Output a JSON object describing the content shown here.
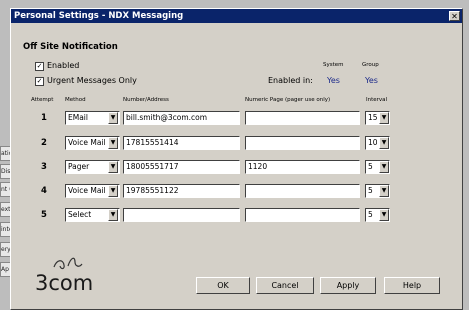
{
  "background": {
    "strips": [
      "ation",
      "Dis",
      "nt (",
      "ext",
      "inte",
      "eryM",
      "Ap"
    ]
  },
  "dialog": {
    "title": "Personal Settings - NDX Messaging",
    "close_glyph": "✕",
    "section_title": "Off Site Notification",
    "enabled_label": "Enabled",
    "enabled_checked": "✓",
    "urgent_label": "Urgent Messages Only",
    "urgent_checked": "✓",
    "enabled_in_label": "Enabled in:",
    "system_header": "System",
    "group_header": "Group",
    "system_value": "Yes",
    "group_value": "Yes",
    "columns": {
      "attempt": "Attempt",
      "method": "Method",
      "number": "Number/Address",
      "page": "Numeric Page (pager use only)",
      "interval": "Interval"
    },
    "rows": [
      {
        "attempt": "1",
        "method": "EMail",
        "number": "bill.smith@3com.com",
        "page": "",
        "interval": "15"
      },
      {
        "attempt": "2",
        "method": "Voice Mail",
        "number": "17815551414",
        "page": "",
        "interval": "10"
      },
      {
        "attempt": "3",
        "method": "Pager",
        "number": "18005551717",
        "page": "1120",
        "interval": "5"
      },
      {
        "attempt": "4",
        "method": "Voice Mail",
        "number": "19785551122",
        "page": "",
        "interval": "5"
      },
      {
        "attempt": "5",
        "method": "Select",
        "number": "",
        "page": "",
        "interval": "5"
      }
    ],
    "logo_text": "3com",
    "buttons": {
      "ok": "OK",
      "cancel": "Cancel",
      "apply": "Apply",
      "help": "Help"
    },
    "dropdown_arrow": "▼"
  }
}
